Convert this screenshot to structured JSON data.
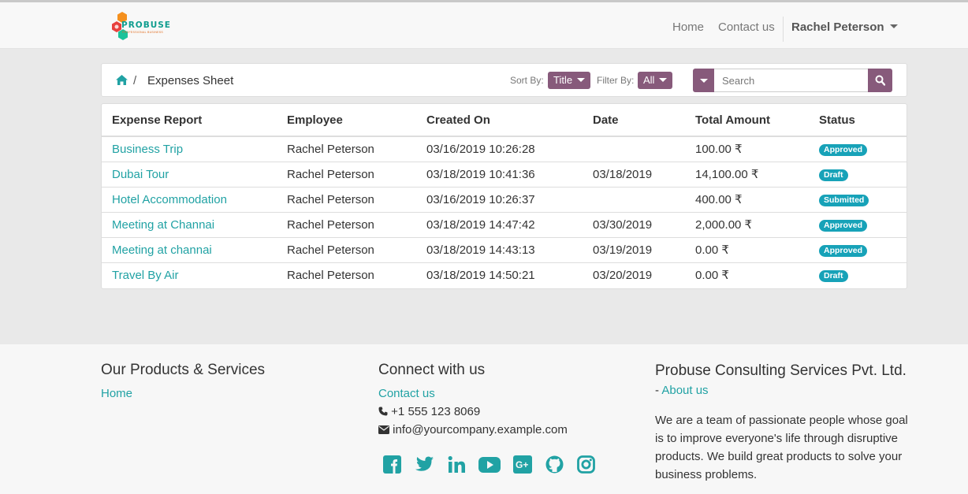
{
  "navbar": {
    "logo_text": "PROBUSE",
    "logo_subtext": "PROFESSIONAL BUSINESS",
    "links": [
      "Home",
      "Contact us"
    ],
    "user": "Rachel Peterson"
  },
  "breadcrumb": {
    "home_icon": "home-icon",
    "separator": "/",
    "current": "Expenses Sheet"
  },
  "controls": {
    "sort_label": "Sort By:",
    "sort_value": "Title",
    "filter_label": "Filter By:",
    "filter_value": "All",
    "search_placeholder": "Search"
  },
  "table": {
    "headers": [
      "Expense Report",
      "Employee",
      "Created On",
      "Date",
      "Total Amount",
      "Status"
    ],
    "rows": [
      {
        "report": "Business Trip",
        "employee": "Rachel Peterson",
        "created": "03/16/2019 10:26:28",
        "date": "",
        "amount": "100.00 ₹",
        "status": "Approved"
      },
      {
        "report": "Dubai Tour",
        "employee": "Rachel Peterson",
        "created": "03/18/2019 10:41:36",
        "date": "03/18/2019",
        "amount": "14,100.00 ₹",
        "status": "Draft"
      },
      {
        "report": "Hotel Accommodation",
        "employee": "Rachel Peterson",
        "created": "03/16/2019 10:26:37",
        "date": "",
        "amount": "400.00 ₹",
        "status": "Submitted"
      },
      {
        "report": "Meeting at Channai",
        "employee": "Rachel Peterson",
        "created": "03/18/2019 14:47:42",
        "date": "03/30/2019",
        "amount": "2,000.00 ₹",
        "status": "Approved"
      },
      {
        "report": "Meeting at channai",
        "employee": "Rachel Peterson",
        "created": "03/18/2019 14:43:13",
        "date": "03/19/2019",
        "amount": "0.00 ₹",
        "status": "Approved"
      },
      {
        "report": "Travel By Air",
        "employee": "Rachel Peterson",
        "created": "03/18/2019 14:50:21",
        "date": "03/20/2019",
        "amount": "0.00 ₹",
        "status": "Draft"
      }
    ]
  },
  "footer": {
    "products": {
      "title": "Our Products & Services",
      "link": "Home"
    },
    "connect": {
      "title": "Connect with us",
      "link": "Contact us",
      "phone": "+1 555 123 8069",
      "email": "info@yourcompany.example.com",
      "social_icons": [
        "facebook-icon",
        "twitter-icon",
        "linkedin-icon",
        "youtube-icon",
        "google-plus-icon",
        "github-icon",
        "instagram-icon"
      ]
    },
    "company": {
      "title": "Probuse Consulting Services Pvt. Ltd.",
      "title_sep": " - ",
      "about_link": "About us",
      "description": "We are a team of passionate people whose goal is to improve everyone's life through disruptive products. We build great products to solve your business problems."
    }
  },
  "colors": {
    "accent": "#875a7b",
    "link": "#21a2a4",
    "badge": "#17a2b8"
  }
}
